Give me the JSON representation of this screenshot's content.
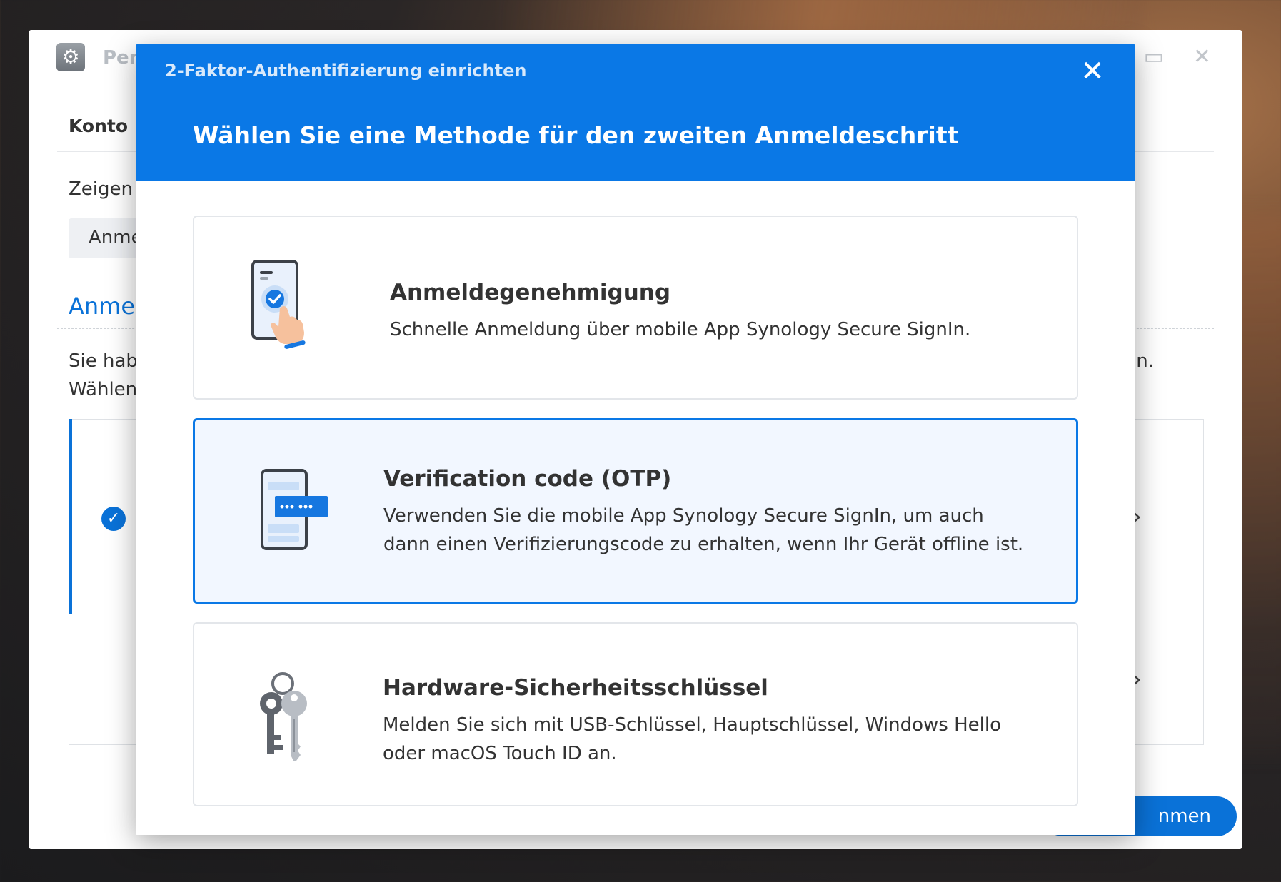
{
  "background_window": {
    "app_title": "Per",
    "tab_label": "Konto",
    "section_label": "Zeigen",
    "chip_text": "Anme",
    "section_heading": "Anmel",
    "desc_line1": "Sie hab",
    "desc_line2": "Wählen",
    "desc_tail": "n.",
    "footer_button": "nmen",
    "window_icons": {
      "maximize": "maximize-icon",
      "close": "close-icon"
    }
  },
  "dialog": {
    "title": "2-Faktor-Authentifizierung einrichten",
    "heading": "Wählen Sie eine Methode für den zweiten Anmeldeschritt",
    "close_icon": "close-icon",
    "header_color": "#0a78e6",
    "selected_border_color": "#0a78e6",
    "options": [
      {
        "icon": "phone-approval-icon",
        "title": "Anmeldegenehmigung",
        "description": [
          "Schnelle Anmeldung über mobile App Synology Secure SignIn."
        ],
        "selected": false
      },
      {
        "icon": "phone-otp-icon",
        "title": "Verification code (OTP)",
        "description": [
          "Verwenden Sie die mobile App Synology Secure SignIn, um auch",
          "dann einen Verifizierungscode zu erhalten, wenn Ihr Gerät offline ist."
        ],
        "selected": true
      },
      {
        "icon": "keys-icon",
        "title": "Hardware-Sicherheitsschlüssel",
        "description": [
          "Melden Sie sich mit USB-Schlüssel, Hauptschlüssel, Windows Hello",
          "oder macOS Touch ID an."
        ],
        "selected": false
      }
    ]
  }
}
